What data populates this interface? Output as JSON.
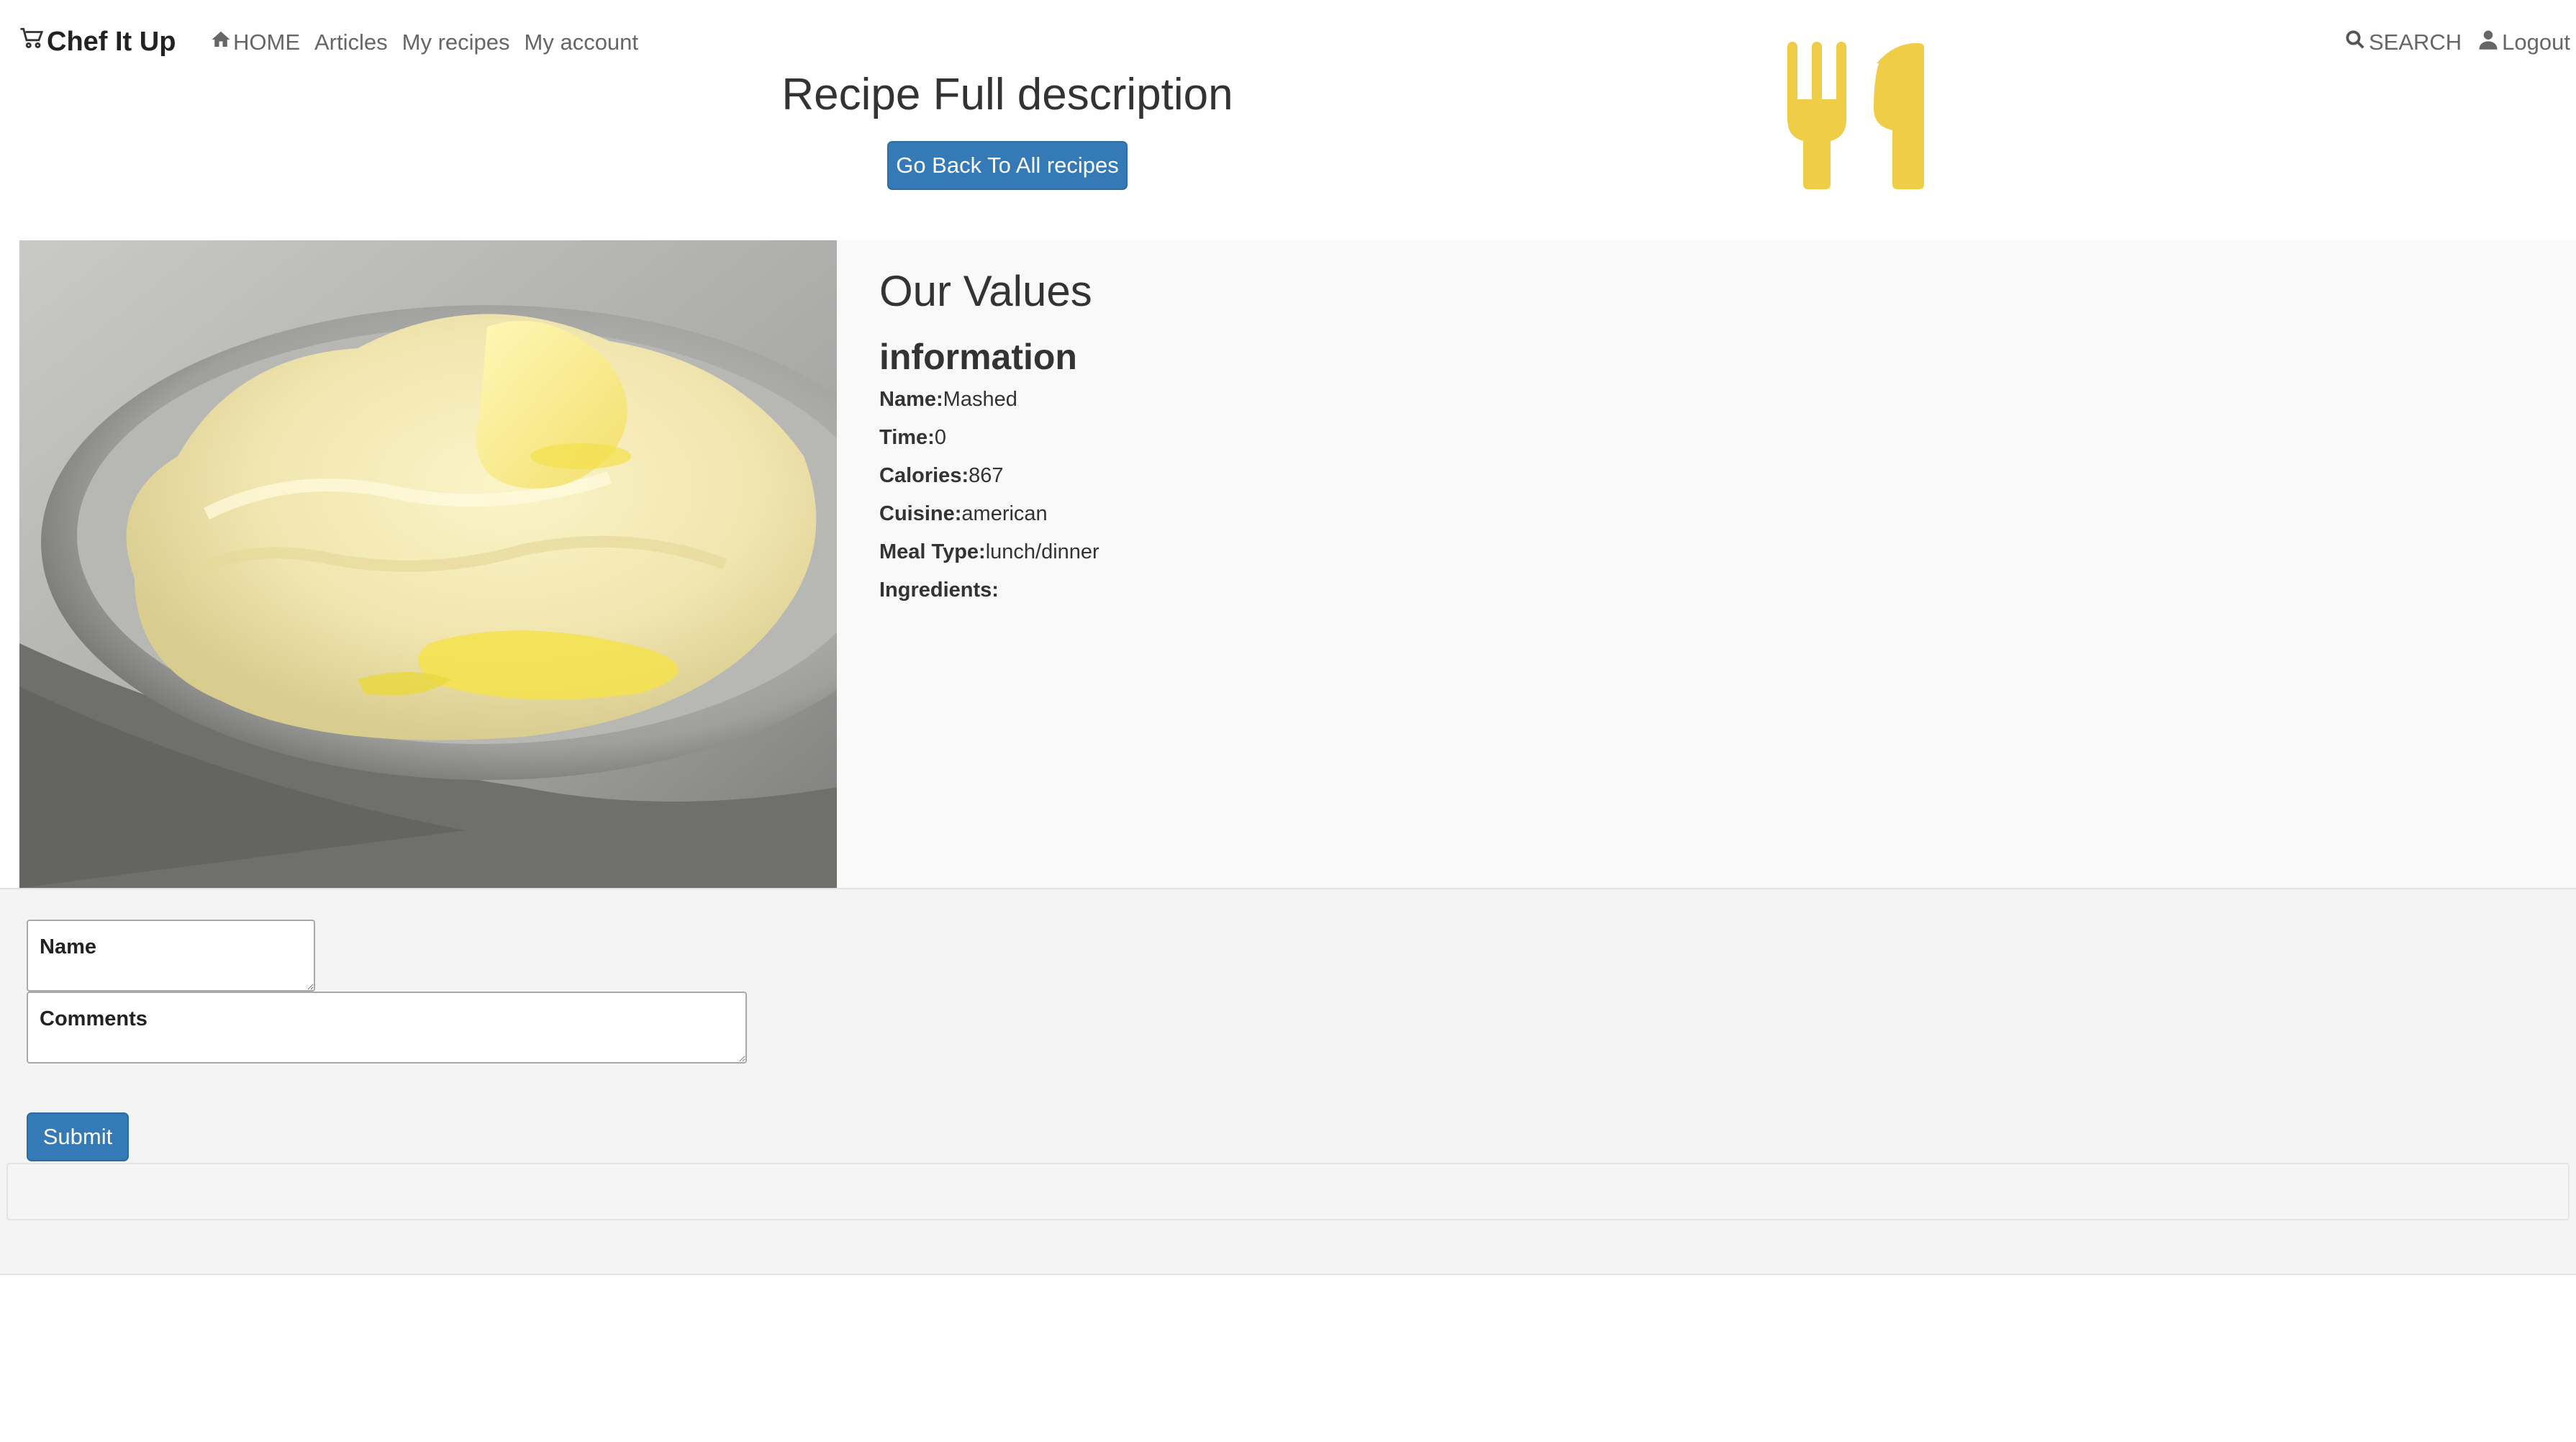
{
  "nav": {
    "brand": "Chef It Up",
    "links": [
      {
        "label": "HOME",
        "icon": "home-icon"
      },
      {
        "label": "Articles"
      },
      {
        "label": "My recipes"
      },
      {
        "label": "My account"
      }
    ],
    "right": [
      {
        "label": "SEARCH",
        "icon": "search-icon"
      },
      {
        "label": "Logout",
        "icon": "user-icon"
      }
    ]
  },
  "header": {
    "title": "Recipe Full description",
    "back_button": "Go Back To All recipes"
  },
  "colors": {
    "primary": "#337ab7",
    "cutlery": "#f0cd46"
  },
  "recipe": {
    "section_title": "Our Values",
    "subtitle": "information",
    "fields": [
      {
        "label": "Name:",
        "value": "Mashed"
      },
      {
        "label": "Time:",
        "value": "0"
      },
      {
        "label": "Calories:",
        "value": "867"
      },
      {
        "label": "Cuisine:",
        "value": "american"
      },
      {
        "label": "Meal Type:",
        "value": "lunch/dinner"
      },
      {
        "label": "Ingredients:",
        "value": ""
      }
    ]
  },
  "comment_form": {
    "name_placeholder": "Name",
    "comments_placeholder": "Comments",
    "submit_label": "Submit"
  }
}
